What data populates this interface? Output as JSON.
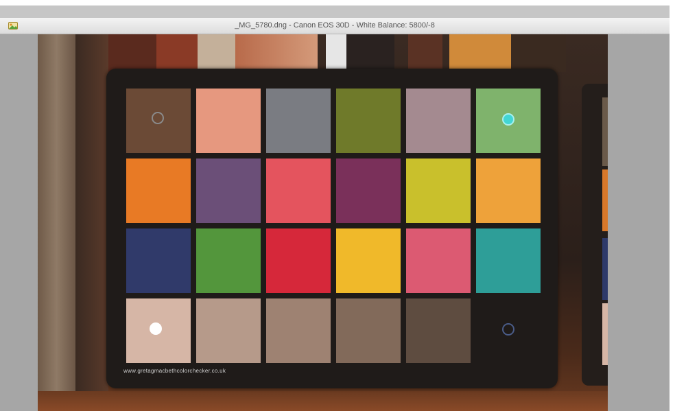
{
  "window": {
    "title": "_MG_5780.dng - Canon EOS 30D - White Balance: 5800/-8"
  },
  "footer": {
    "site_text": "www.gretagmacbethcolorchecker.co.uk"
  },
  "colors": {
    "card": "#1f1b19",
    "viewer_background": "#a6a6a6",
    "sampler_gray": "#8a8a8a",
    "sampler_cyan": "#42d6d4",
    "sampler_white": "#ffffff",
    "sampler_blue": "#4a5c88"
  },
  "patches": [
    {
      "name": "dark-skin",
      "color": "#6b4a36"
    },
    {
      "name": "light-skin",
      "color": "#e6987f"
    },
    {
      "name": "blue-sky",
      "color": "#7a7c82"
    },
    {
      "name": "foliage",
      "color": "#6f7a2a"
    },
    {
      "name": "blue-flower",
      "color": "#a48a90"
    },
    {
      "name": "bluish-green",
      "color": "#7fb36c"
    },
    {
      "name": "orange",
      "color": "#e87a25"
    },
    {
      "name": "purplish-blue",
      "color": "#6b4f78"
    },
    {
      "name": "moderate-red",
      "color": "#e4545e"
    },
    {
      "name": "purple",
      "color": "#7a305a"
    },
    {
      "name": "yellow-green",
      "color": "#c9c02c"
    },
    {
      "name": "orange-yellow",
      "color": "#eea23a"
    },
    {
      "name": "blue",
      "color": "#303a6a"
    },
    {
      "name": "green",
      "color": "#53963c"
    },
    {
      "name": "red",
      "color": "#d6283a"
    },
    {
      "name": "yellow",
      "color": "#f0b92a"
    },
    {
      "name": "magenta",
      "color": "#dc5a72"
    },
    {
      "name": "cyan",
      "color": "#2e9e98"
    },
    {
      "name": "white",
      "color": "#d6b6a6"
    },
    {
      "name": "neutral-8",
      "color": "#b69a8a"
    },
    {
      "name": "neutral-6-5",
      "color": "#9e8272"
    },
    {
      "name": "neutral-5",
      "color": "#826a5a"
    },
    {
      "name": "neutral-3-5",
      "color": "#5e4c40"
    },
    {
      "name": "black",
      "color": "#2a2220"
    }
  ]
}
